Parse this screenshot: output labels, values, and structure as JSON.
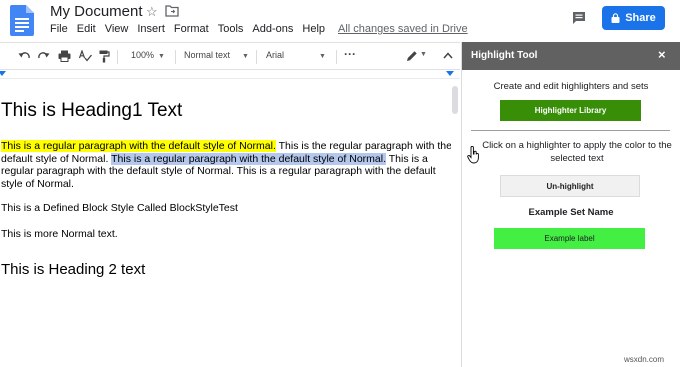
{
  "title_bar": {
    "doc_title": "My Document",
    "menu": [
      "File",
      "Edit",
      "View",
      "Insert",
      "Format",
      "Tools",
      "Add-ons",
      "Help"
    ],
    "saved_status": "All changes saved in Drive",
    "share_label": "Share",
    "brand_color": "#1a73e8"
  },
  "toolbar": {
    "zoom": "100%",
    "style": "Normal text",
    "font": "Arial",
    "more": "···",
    "icons": [
      "undo-icon",
      "redo-icon",
      "print-icon",
      "spellcheck-icon",
      "paint-format-icon",
      "pen-icon",
      "collapse-icon"
    ]
  },
  "document": {
    "heading1": "This is Heading1 Text",
    "para_yellow": "This is a regular paragraph with the default style of Normal.",
    "para_mid": " This is the regular paragraph with the default style of Normal. ",
    "para_blue": "This is a regular paragraph with the default style of Normal.",
    "para_tail": " This is a regular paragraph with the default style of Normal. This is a regular paragraph with the default style of Normal.",
    "block_style": "This is a Defined Block Style Called BlockStyleTest",
    "more_normal": "This is more Normal text.",
    "heading2": "This is Heading 2 text",
    "highlight_colors": {
      "yellow": "#ffff00",
      "blue": "#b4c7ec"
    }
  },
  "sidebar": {
    "title": "Highlight Tool",
    "close": "×",
    "intro": "Create and edit highlighters and sets",
    "library_button": "Highlighter Library",
    "instructions": "Click on a highlighter to apply the color to the selected text",
    "unhighlight_button": "Un-highlight",
    "set_name": "Example Set Name",
    "example_label": "Example label",
    "colors": {
      "header": "#616161",
      "library": "#388e07",
      "label": "#44ef44"
    }
  },
  "watermark": "wsxdn.com"
}
